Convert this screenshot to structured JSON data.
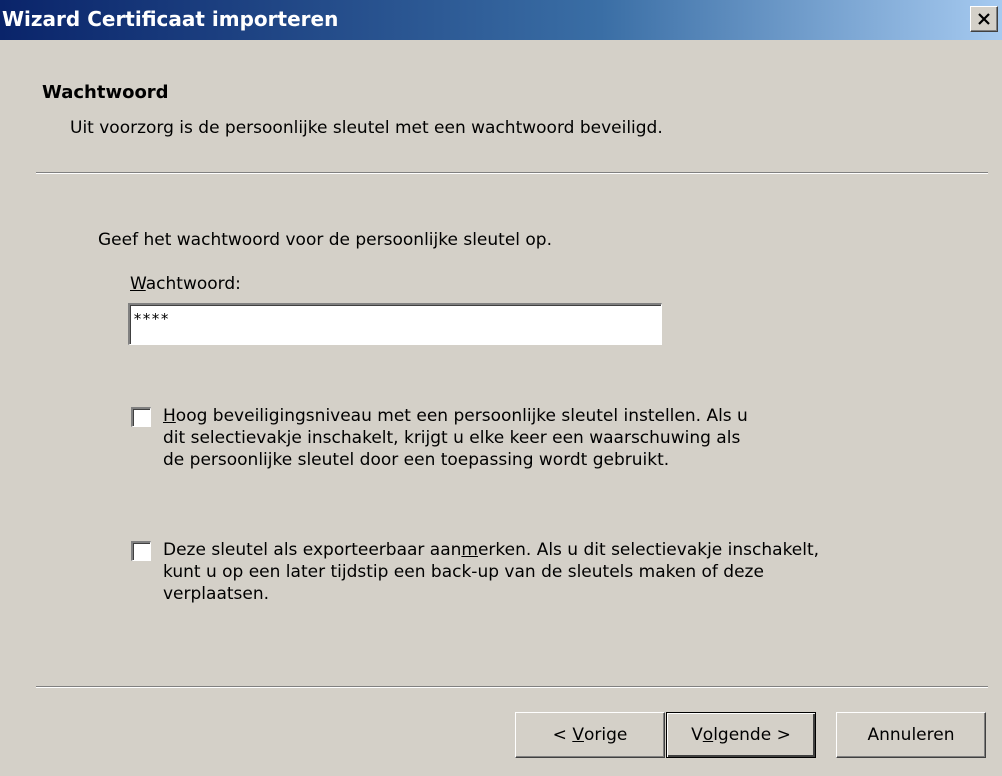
{
  "window": {
    "title": "Wizard Certificaat importeren",
    "close_label": "×"
  },
  "header": {
    "title": "Wachtwoord",
    "subtitle": "Uit voorzorg is de persoonlijke sleutel met een wachtwoord beveiligd."
  },
  "body": {
    "instruction": "Geef het wachtwoord voor de persoonlijke sleutel op.",
    "password_label_mnemonic": "W",
    "password_label_rest": "achtwoord:",
    "password_value": "****"
  },
  "options": [
    {
      "mnemonic": "H",
      "line1_rest": "oog beveiligingsniveau met een persoonlijke sleutel instellen. Als u",
      "line2": "dit selectievakje inschakelt, krijgt u elke keer een waarschuwing als",
      "line3": "de persoonlijke sleutel door een toepassing wordt gebruikt.",
      "checked": false
    },
    {
      "line1_pre": "Deze sleutel als exporteerbaar aan",
      "mnemonic": "m",
      "line1_rest": "erken. Als u dit selectievakje inschakelt,",
      "line2": "kunt u op een later tijdstip een back-up van de sleutels maken of deze",
      "line3": "verplaatsen.",
      "checked": false
    }
  ],
  "buttons": {
    "back_pre": "< ",
    "back_mnemonic": "V",
    "back_rest": "orige",
    "next_pre": "V",
    "next_mnemonic": "o",
    "next_rest": "lgende >",
    "cancel": "Annuleren"
  },
  "colors": {
    "dialog_bg": "#d4d0c8",
    "titlebar_start": "#0a246a",
    "titlebar_end": "#a6caf0",
    "title_text": "#ffffff"
  }
}
